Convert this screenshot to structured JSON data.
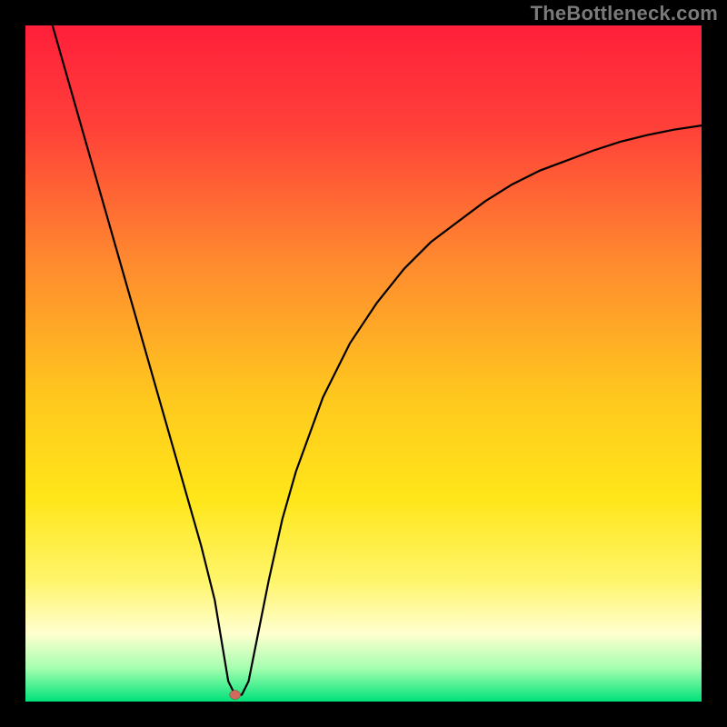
{
  "watermark": "TheBottleneck.com",
  "colors": {
    "frame": "#000000",
    "watermark": "#7a7a7a",
    "curve": "#000000",
    "gradient_stops": [
      {
        "offset": 0.0,
        "color": "#ff1f3a"
      },
      {
        "offset": 0.15,
        "color": "#ff4039"
      },
      {
        "offset": 0.35,
        "color": "#ff8a2f"
      },
      {
        "offset": 0.55,
        "color": "#ffc81e"
      },
      {
        "offset": 0.7,
        "color": "#ffe61a"
      },
      {
        "offset": 0.82,
        "color": "#fff56a"
      },
      {
        "offset": 0.9,
        "color": "#ffffd0"
      },
      {
        "offset": 0.95,
        "color": "#a6ffb0"
      },
      {
        "offset": 1.0,
        "color": "#00e27a"
      }
    ],
    "marker": "#cf6a5c"
  },
  "chart_data": {
    "type": "line",
    "title": "",
    "xlabel": "",
    "ylabel": "",
    "xlim": [
      0,
      100
    ],
    "ylim": [
      0,
      100
    ],
    "grid": false,
    "legend": false,
    "series": [
      {
        "name": "bottleneck-curve",
        "x": [
          4,
          6,
          8,
          10,
          12,
          14,
          16,
          18,
          20,
          22,
          24,
          26,
          28,
          29,
          30,
          31,
          32,
          33,
          34,
          36,
          38,
          40,
          44,
          48,
          52,
          56,
          60,
          64,
          68,
          72,
          76,
          80,
          84,
          88,
          92,
          96,
          100
        ],
        "y": [
          100,
          93,
          86,
          79,
          72,
          65,
          58,
          51,
          44,
          37,
          30,
          23,
          15,
          9,
          3,
          1,
          1,
          3,
          8,
          18,
          27,
          34,
          45,
          53,
          59,
          64,
          68,
          71,
          74,
          76.5,
          78.5,
          80,
          81.5,
          82.8,
          83.8,
          84.6,
          85.2
        ]
      }
    ],
    "marker": {
      "x": 31,
      "y": 1,
      "name": "optimal-point"
    }
  }
}
